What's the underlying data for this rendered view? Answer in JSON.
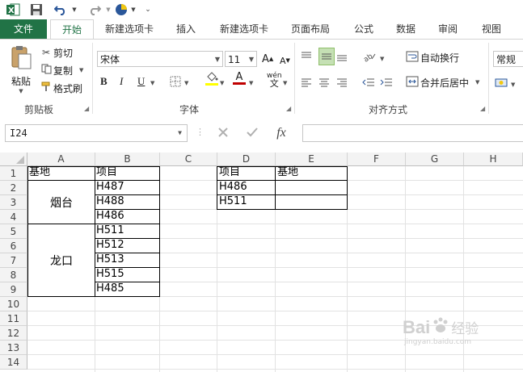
{
  "ribbon_tabs": [
    "文件",
    "开始",
    "新建选项卡",
    "插入",
    "新建选项卡",
    "页面布局",
    "公式",
    "数据",
    "审阅",
    "视图"
  ],
  "clipboard": {
    "paste": "粘贴",
    "cut": "剪切",
    "copy": "复制",
    "format_painter": "格式刷",
    "group": "剪贴板"
  },
  "font": {
    "name": "宋体",
    "size": "11",
    "bold": "B",
    "italic": "I",
    "underline": "U",
    "phonetic": "wén",
    "group": "字体"
  },
  "alignment": {
    "wrap": "自动换行",
    "merge": "合并后居中",
    "group": "对齐方式"
  },
  "number": {
    "format": "常规"
  },
  "formula_bar": {
    "name_box": "I24",
    "fx": "fx",
    "value": ""
  },
  "columns": [
    "A",
    "B",
    "C",
    "D",
    "E",
    "F",
    "G",
    "H"
  ],
  "rows": [
    "1",
    "2",
    "3",
    "4",
    "5",
    "6",
    "7",
    "8",
    "9",
    "10",
    "11",
    "12",
    "13",
    "14"
  ],
  "sheet": {
    "a1": "基地",
    "b1": "项目",
    "yantai": "烟台",
    "longkou": "龙口",
    "b_col": [
      "H487",
      "H488",
      "H486",
      "H511",
      "H512",
      "H513",
      "H515",
      "H485"
    ],
    "d1": "项目",
    "e1": "基地",
    "d_col": [
      "H486",
      "H511"
    ]
  },
  "watermark": {
    "brand": "Bai",
    "brand2": "经验",
    "url": "jingyan.baidu.com"
  }
}
